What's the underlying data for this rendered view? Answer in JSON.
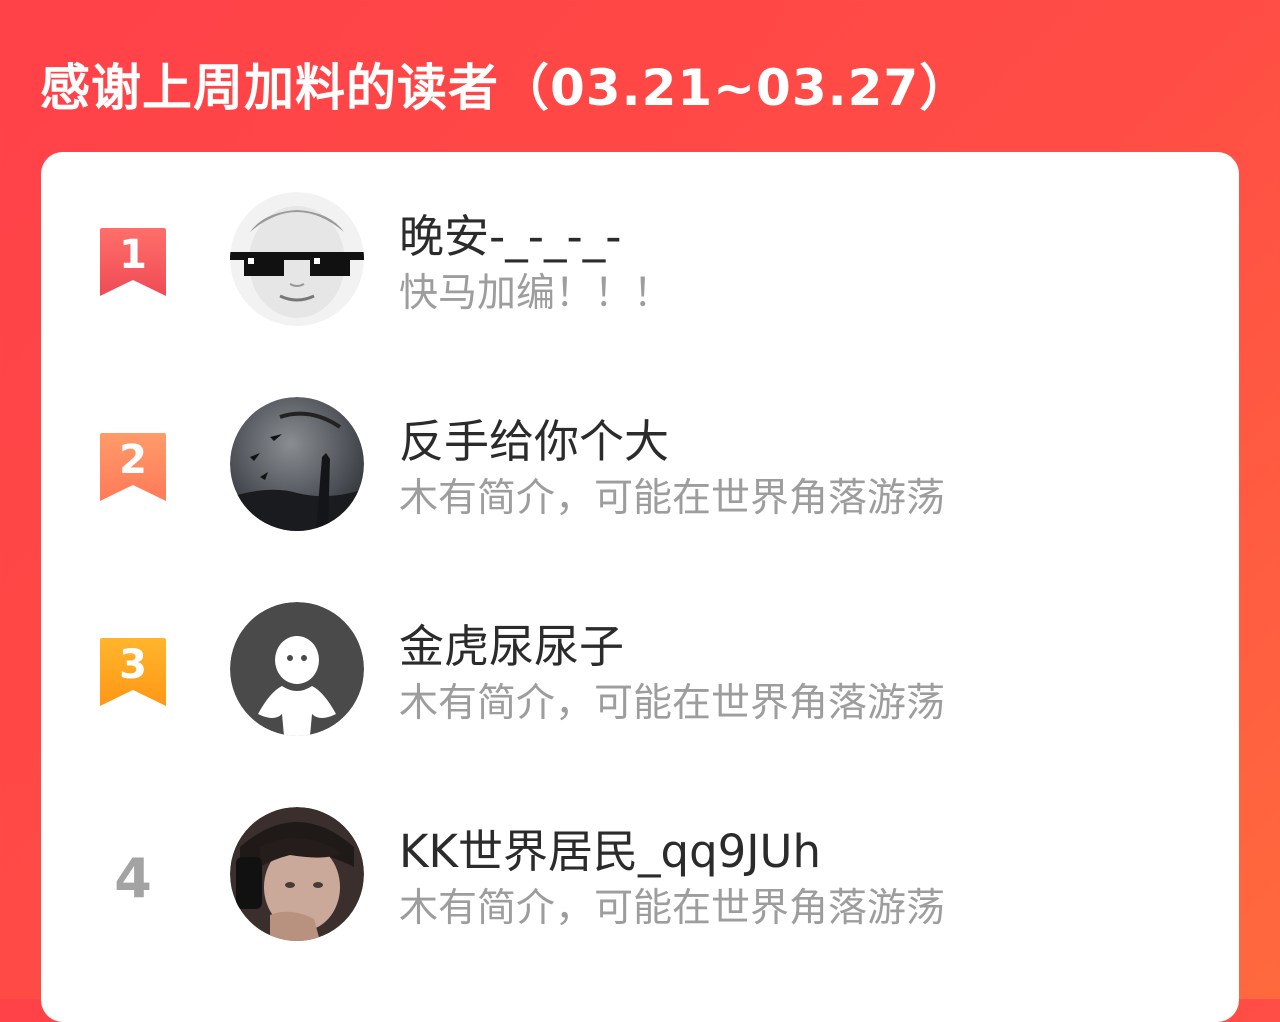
{
  "header": {
    "title": "感谢上周加料的读者（03.21~03.27）"
  },
  "readers": [
    {
      "rank": "1",
      "name": "晚安-_-_-_-",
      "intro": "快马加编！！！"
    },
    {
      "rank": "2",
      "name": "反手给你个大",
      "intro": "木有简介，可能在世界角落游荡"
    },
    {
      "rank": "3",
      "name": "金虎尿尿子",
      "intro": "木有简介，可能在世界角落游荡"
    },
    {
      "rank": "4",
      "name": "KK世界居民_qq9JUh",
      "intro": "木有简介，可能在世界角落游荡"
    }
  ],
  "colors": {
    "background": "#ff4148",
    "card": "#ffffff",
    "rank1_badge": "#f45a5f",
    "rank2_badge": "#ff8a5c",
    "rank3_badge": "#ffa11f",
    "rank4_text": "#a3a3a3"
  },
  "icons": {
    "rank_badge": "ribbon-badge-icon",
    "avatar_default": "default-user-icon"
  }
}
